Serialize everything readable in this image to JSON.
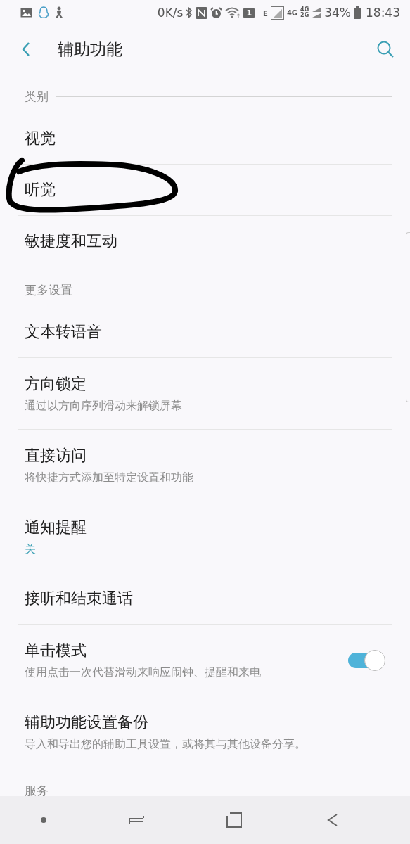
{
  "status_bar": {
    "speed": "0K/s",
    "sim": "1",
    "network_e": "E",
    "network_4g": "4G",
    "network_4g_top": "4G",
    "network_2g": "2G",
    "battery": "34%",
    "time": "18:43"
  },
  "header": {
    "title": "辅助功能"
  },
  "sections": [
    {
      "title": "类别",
      "items": [
        {
          "kind": "plain",
          "title": "视觉"
        },
        {
          "kind": "plain",
          "title": "听觉",
          "circled": true
        },
        {
          "kind": "plain",
          "title": "敏捷度和互动"
        }
      ]
    },
    {
      "title": "更多设置",
      "items": [
        {
          "kind": "plain",
          "title": "文本转语音"
        },
        {
          "kind": "subtitle",
          "title": "方向锁定",
          "subtitle": "通过以方向序列滑动来解锁屏幕"
        },
        {
          "kind": "subtitle",
          "title": "直接访问",
          "subtitle": "将快捷方式添加至特定设置和功能"
        },
        {
          "kind": "value",
          "title": "通知提醒",
          "value": "关"
        },
        {
          "kind": "plain",
          "title": "接听和结束通话"
        },
        {
          "kind": "toggle",
          "title": "单击模式",
          "subtitle": "使用点击一次代替滑动来响应闹钟、提醒和来电",
          "on": true
        },
        {
          "kind": "subtitle",
          "title": "辅助功能设置备份",
          "subtitle": "导入和导出您的辅助工具设置，或将其与其他设备分享。"
        }
      ]
    },
    {
      "title": "服务"
    }
  ]
}
